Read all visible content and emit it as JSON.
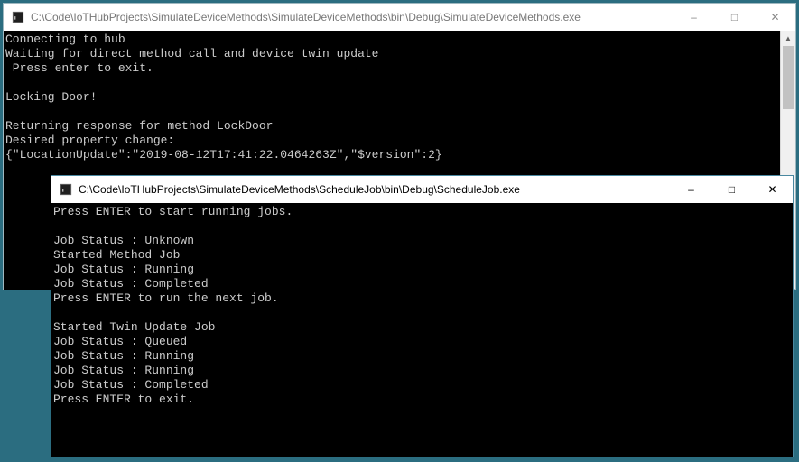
{
  "icon_colors": {
    "term_bg": "#1f1f1f",
    "term_border": "#6a6a6a",
    "caret": "#bfbfbf"
  },
  "window1": {
    "title": "C:\\Code\\IoTHubProjects\\SimulateDeviceMethods\\SimulateDeviceMethods\\bin\\Debug\\SimulateDeviceMethods.exe",
    "min": "–",
    "max": "□",
    "close": "✕",
    "sb_up": "▲",
    "sb_down": "▼",
    "body": "Connecting to hub\nWaiting for direct method call and device twin update\n Press enter to exit.\n\nLocking Door!\n\nReturning response for method LockDoor\nDesired property change:\n{\"LocationUpdate\":\"2019-08-12T17:41:22.0464263Z\",\"$version\":2}"
  },
  "window2": {
    "title": "C:\\Code\\IoTHubProjects\\SimulateDeviceMethods\\ScheduleJob\\bin\\Debug\\ScheduleJob.exe",
    "min": "–",
    "max": "□",
    "close": "✕",
    "body": "Press ENTER to start running jobs.\n\nJob Status : Unknown\nStarted Method Job\nJob Status : Running\nJob Status : Completed\nPress ENTER to run the next job.\n\nStarted Twin Update Job\nJob Status : Queued\nJob Status : Running\nJob Status : Running\nJob Status : Completed\nPress ENTER to exit."
  }
}
